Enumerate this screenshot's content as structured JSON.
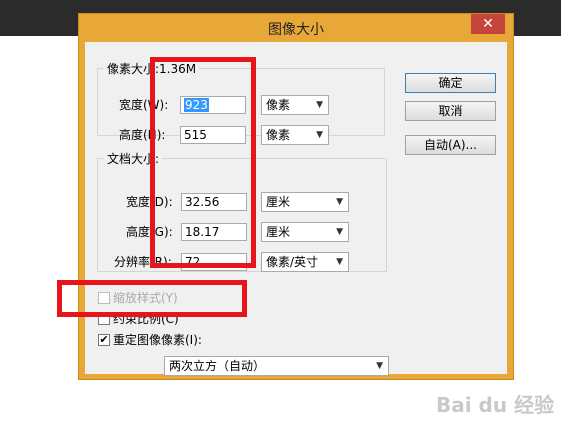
{
  "window": {
    "title": "图像大小",
    "close_glyph": "✕"
  },
  "pixel_dims": {
    "legend": "像素大小:1.36M",
    "width": {
      "label": "宽度(W):",
      "value": "923",
      "unit": "像素"
    },
    "height": {
      "label": "高度(H):",
      "value": "515",
      "unit": "像素"
    }
  },
  "doc_size": {
    "legend": "文档大小:",
    "width": {
      "label": "宽度(D):",
      "value": "32.56",
      "unit": "厘米"
    },
    "height": {
      "label": "高度(G):",
      "value": "18.17",
      "unit": "厘米"
    },
    "resolution": {
      "label": "分辨率(R):",
      "value": "72",
      "unit": "像素/英寸"
    }
  },
  "options": {
    "scale_styles": {
      "label": "缩放样式(Y)",
      "checked": false,
      "enabled": false
    },
    "constrain": {
      "label": "约束比例(C)",
      "checked": false
    },
    "resample": {
      "label": "重定图像像素(I):",
      "checked": true,
      "check_glyph": "✔"
    },
    "method": "两次立方（自动）"
  },
  "buttons": {
    "ok": "确定",
    "cancel": "取消",
    "auto": "自动(A)..."
  },
  "watermark": "Bai du 经验",
  "icons": {
    "dropdown_arrow": "▼"
  }
}
